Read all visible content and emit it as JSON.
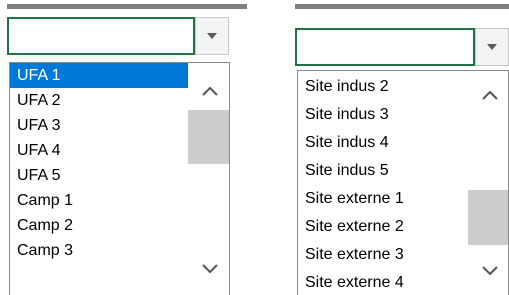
{
  "left_dropdown": {
    "input_value": "",
    "items": [
      "UFA 1",
      "UFA 2",
      "UFA 3",
      "UFA 4",
      "UFA 5",
      "Camp 1",
      "Camp 2",
      "Camp 3"
    ],
    "selected_index": 0,
    "scroll_up_icon": "chevron-up-icon",
    "scroll_down_icon": "chevron-down-icon"
  },
  "right_dropdown": {
    "input_value": "",
    "items": [
      "Site indus 2",
      "Site indus 3",
      "Site indus 4",
      "Site indus 5",
      "Site externe 1",
      "Site externe 2",
      "Site externe 3",
      "Site externe 4"
    ],
    "scroll_up_icon": "chevron-up-icon",
    "scroll_down_icon": "chevron-down-icon"
  },
  "colors": {
    "selection": "#0078d7",
    "input_border": "#217346",
    "scroll_thumb": "#cdcdcd"
  }
}
